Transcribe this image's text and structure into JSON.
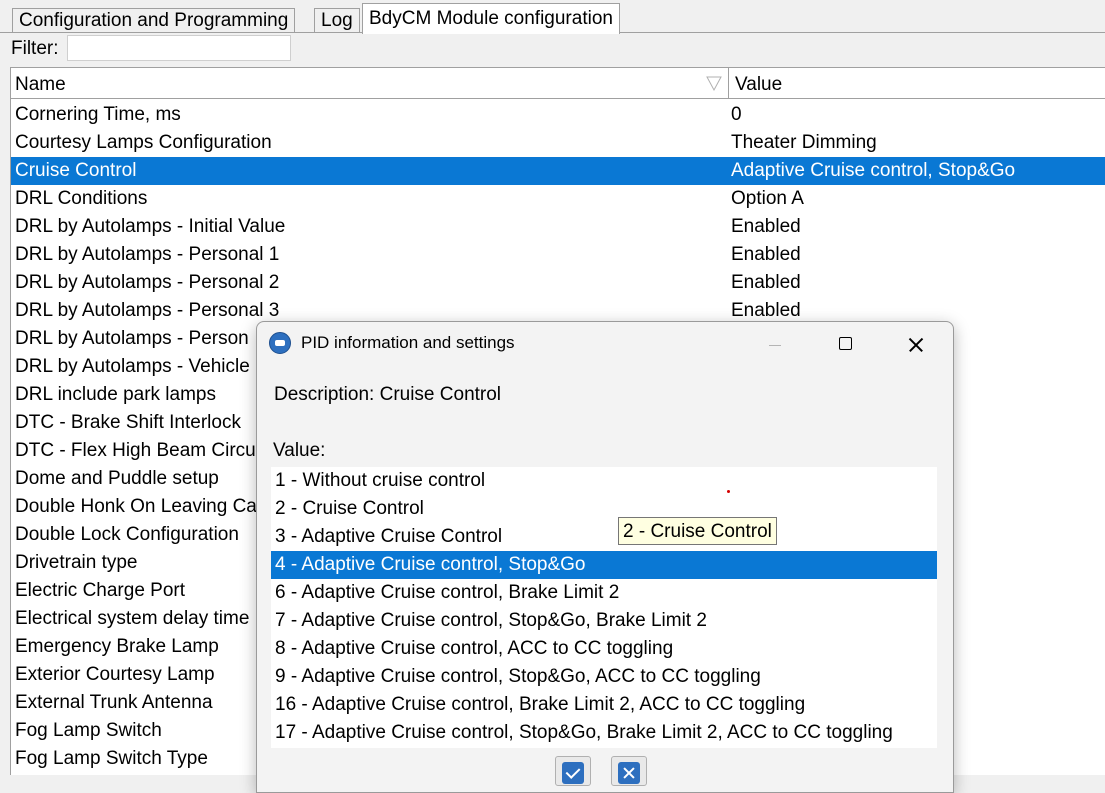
{
  "tabs": [
    {
      "label": "Configuration and Programming"
    },
    {
      "label": "Log"
    },
    {
      "label": "BdyCM Module configuration"
    }
  ],
  "filter": {
    "label": "Filter:",
    "value": ""
  },
  "grid": {
    "columns": {
      "name": "Name",
      "value": "Value"
    },
    "rows": [
      {
        "name": "Cornering Time, ms",
        "value": "0"
      },
      {
        "name": "Courtesy Lamps Configuration",
        "value": "Theater Dimming"
      },
      {
        "name": "Cruise Control",
        "value": "Adaptive Cruise control, Stop&Go"
      },
      {
        "name": "DRL Conditions",
        "value": "Option A"
      },
      {
        "name": "DRL by Autolamps - Initial Value",
        "value": "Enabled"
      },
      {
        "name": "DRL by Autolamps - Personal 1",
        "value": "Enabled"
      },
      {
        "name": "DRL by Autolamps - Personal 2",
        "value": "Enabled"
      },
      {
        "name": "DRL by Autolamps - Personal 3",
        "value": "Enabled"
      },
      {
        "name": "DRL by Autolamps - Person",
        "value": ""
      },
      {
        "name": "DRL by Autolamps - Vehicle",
        "value": ""
      },
      {
        "name": "DRL include park lamps",
        "value": ""
      },
      {
        "name": "DTC - Brake Shift Interlock",
        "value": ""
      },
      {
        "name": "DTC - Flex High Beam Circu",
        "value": ""
      },
      {
        "name": "Dome and Puddle setup",
        "value": ""
      },
      {
        "name": "Double Honk On Leaving Ca",
        "value": ""
      },
      {
        "name": "Double Lock Configuration",
        "value": ""
      },
      {
        "name": "Drivetrain type",
        "value": ""
      },
      {
        "name": "Electric Charge Port",
        "value": ""
      },
      {
        "name": "Electrical system delay time",
        "value": ""
      },
      {
        "name": "Emergency Brake Lamp",
        "value": ""
      },
      {
        "name": "Exterior Courtesy Lamp",
        "value": ""
      },
      {
        "name": "External Trunk Antenna",
        "value": ""
      },
      {
        "name": "Fog Lamp Switch",
        "value": ""
      },
      {
        "name": "Fog Lamp Switch Type",
        "value": ""
      }
    ],
    "selected_index": 2
  },
  "dialog": {
    "title": "PID information and settings",
    "description": "Description: Cruise Control",
    "value_label": "Value:",
    "options": [
      "1 - Without cruise control",
      "2 - Cruise Control",
      "3 - Adaptive Cruise Control",
      "4 - Adaptive Cruise control, Stop&Go",
      "6 - Adaptive Cruise control, Brake Limit 2",
      "7 - Adaptive Cruise control, Stop&Go, Brake Limit 2",
      "8 - Adaptive Cruise control, ACC to CC toggling",
      "9 - Adaptive Cruise control, Stop&Go, ACC to CC toggling",
      "16 - Adaptive Cruise control, Brake Limit 2, ACC to CC toggling",
      "17 - Adaptive Cruise control, Stop&Go, Brake Limit 2, ACC to CC toggling"
    ],
    "selected_index": 3,
    "tooltip": "2 - Cruise Control"
  },
  "colors": {
    "selection": "#0a78d4",
    "tooltip_bg": "#ffffe1",
    "accent_icon": "#2d6fbf"
  }
}
